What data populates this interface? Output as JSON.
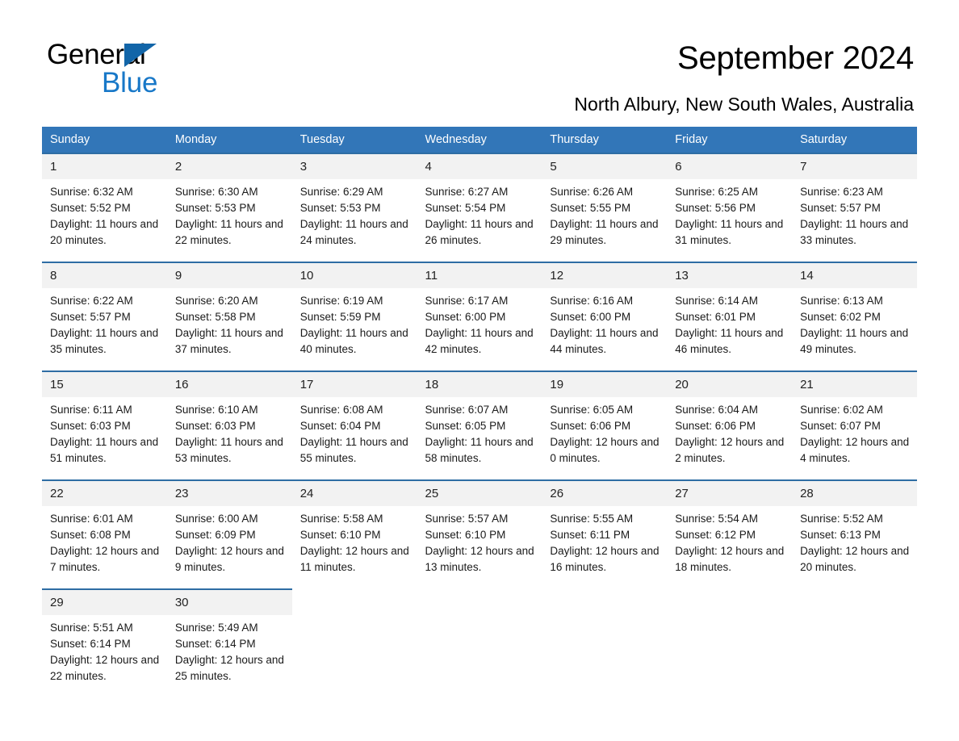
{
  "brand": {
    "name_part1": "General",
    "name_part2": "Blue",
    "accent_color": "#1878c8",
    "triangle_color": "#1265a8"
  },
  "header": {
    "title": "September 2024",
    "location": "North Albury, New South Wales, Australia"
  },
  "theme": {
    "header_bg": "#3276b8",
    "row_border": "#2e6da4",
    "daynum_bg": "#f2f2f2"
  },
  "calendar": {
    "weekday_headers": [
      "Sunday",
      "Monday",
      "Tuesday",
      "Wednesday",
      "Thursday",
      "Friday",
      "Saturday"
    ],
    "labels": {
      "sunrise_prefix": "Sunrise: ",
      "sunset_prefix": "Sunset: ",
      "daylight_prefix": "Daylight: "
    },
    "weeks": [
      [
        {
          "day": "1",
          "sunrise": "Sunrise: 6:32 AM",
          "sunset": "Sunset: 5:52 PM",
          "daylight": "Daylight: 11 hours and 20 minutes."
        },
        {
          "day": "2",
          "sunrise": "Sunrise: 6:30 AM",
          "sunset": "Sunset: 5:53 PM",
          "daylight": "Daylight: 11 hours and 22 minutes."
        },
        {
          "day": "3",
          "sunrise": "Sunrise: 6:29 AM",
          "sunset": "Sunset: 5:53 PM",
          "daylight": "Daylight: 11 hours and 24 minutes."
        },
        {
          "day": "4",
          "sunrise": "Sunrise: 6:27 AM",
          "sunset": "Sunset: 5:54 PM",
          "daylight": "Daylight: 11 hours and 26 minutes."
        },
        {
          "day": "5",
          "sunrise": "Sunrise: 6:26 AM",
          "sunset": "Sunset: 5:55 PM",
          "daylight": "Daylight: 11 hours and 29 minutes."
        },
        {
          "day": "6",
          "sunrise": "Sunrise: 6:25 AM",
          "sunset": "Sunset: 5:56 PM",
          "daylight": "Daylight: 11 hours and 31 minutes."
        },
        {
          "day": "7",
          "sunrise": "Sunrise: 6:23 AM",
          "sunset": "Sunset: 5:57 PM",
          "daylight": "Daylight: 11 hours and 33 minutes."
        }
      ],
      [
        {
          "day": "8",
          "sunrise": "Sunrise: 6:22 AM",
          "sunset": "Sunset: 5:57 PM",
          "daylight": "Daylight: 11 hours and 35 minutes."
        },
        {
          "day": "9",
          "sunrise": "Sunrise: 6:20 AM",
          "sunset": "Sunset: 5:58 PM",
          "daylight": "Daylight: 11 hours and 37 minutes."
        },
        {
          "day": "10",
          "sunrise": "Sunrise: 6:19 AM",
          "sunset": "Sunset: 5:59 PM",
          "daylight": "Daylight: 11 hours and 40 minutes."
        },
        {
          "day": "11",
          "sunrise": "Sunrise: 6:17 AM",
          "sunset": "Sunset: 6:00 PM",
          "daylight": "Daylight: 11 hours and 42 minutes."
        },
        {
          "day": "12",
          "sunrise": "Sunrise: 6:16 AM",
          "sunset": "Sunset: 6:00 PM",
          "daylight": "Daylight: 11 hours and 44 minutes."
        },
        {
          "day": "13",
          "sunrise": "Sunrise: 6:14 AM",
          "sunset": "Sunset: 6:01 PM",
          "daylight": "Daylight: 11 hours and 46 minutes."
        },
        {
          "day": "14",
          "sunrise": "Sunrise: 6:13 AM",
          "sunset": "Sunset: 6:02 PM",
          "daylight": "Daylight: 11 hours and 49 minutes."
        }
      ],
      [
        {
          "day": "15",
          "sunrise": "Sunrise: 6:11 AM",
          "sunset": "Sunset: 6:03 PM",
          "daylight": "Daylight: 11 hours and 51 minutes."
        },
        {
          "day": "16",
          "sunrise": "Sunrise: 6:10 AM",
          "sunset": "Sunset: 6:03 PM",
          "daylight": "Daylight: 11 hours and 53 minutes."
        },
        {
          "day": "17",
          "sunrise": "Sunrise: 6:08 AM",
          "sunset": "Sunset: 6:04 PM",
          "daylight": "Daylight: 11 hours and 55 minutes."
        },
        {
          "day": "18",
          "sunrise": "Sunrise: 6:07 AM",
          "sunset": "Sunset: 6:05 PM",
          "daylight": "Daylight: 11 hours and 58 minutes."
        },
        {
          "day": "19",
          "sunrise": "Sunrise: 6:05 AM",
          "sunset": "Sunset: 6:06 PM",
          "daylight": "Daylight: 12 hours and 0 minutes."
        },
        {
          "day": "20",
          "sunrise": "Sunrise: 6:04 AM",
          "sunset": "Sunset: 6:06 PM",
          "daylight": "Daylight: 12 hours and 2 minutes."
        },
        {
          "day": "21",
          "sunrise": "Sunrise: 6:02 AM",
          "sunset": "Sunset: 6:07 PM",
          "daylight": "Daylight: 12 hours and 4 minutes."
        }
      ],
      [
        {
          "day": "22",
          "sunrise": "Sunrise: 6:01 AM",
          "sunset": "Sunset: 6:08 PM",
          "daylight": "Daylight: 12 hours and 7 minutes."
        },
        {
          "day": "23",
          "sunrise": "Sunrise: 6:00 AM",
          "sunset": "Sunset: 6:09 PM",
          "daylight": "Daylight: 12 hours and 9 minutes."
        },
        {
          "day": "24",
          "sunrise": "Sunrise: 5:58 AM",
          "sunset": "Sunset: 6:10 PM",
          "daylight": "Daylight: 12 hours and 11 minutes."
        },
        {
          "day": "25",
          "sunrise": "Sunrise: 5:57 AM",
          "sunset": "Sunset: 6:10 PM",
          "daylight": "Daylight: 12 hours and 13 minutes."
        },
        {
          "day": "26",
          "sunrise": "Sunrise: 5:55 AM",
          "sunset": "Sunset: 6:11 PM",
          "daylight": "Daylight: 12 hours and 16 minutes."
        },
        {
          "day": "27",
          "sunrise": "Sunrise: 5:54 AM",
          "sunset": "Sunset: 6:12 PM",
          "daylight": "Daylight: 12 hours and 18 minutes."
        },
        {
          "day": "28",
          "sunrise": "Sunrise: 5:52 AM",
          "sunset": "Sunset: 6:13 PM",
          "daylight": "Daylight: 12 hours and 20 minutes."
        }
      ],
      [
        {
          "day": "29",
          "sunrise": "Sunrise: 5:51 AM",
          "sunset": "Sunset: 6:14 PM",
          "daylight": "Daylight: 12 hours and 22 minutes."
        },
        {
          "day": "30",
          "sunrise": "Sunrise: 5:49 AM",
          "sunset": "Sunset: 6:14 PM",
          "daylight": "Daylight: 12 hours and 25 minutes."
        },
        {
          "day": "",
          "sunrise": "",
          "sunset": "",
          "daylight": ""
        },
        {
          "day": "",
          "sunrise": "",
          "sunset": "",
          "daylight": ""
        },
        {
          "day": "",
          "sunrise": "",
          "sunset": "",
          "daylight": ""
        },
        {
          "day": "",
          "sunrise": "",
          "sunset": "",
          "daylight": ""
        },
        {
          "day": "",
          "sunrise": "",
          "sunset": "",
          "daylight": ""
        }
      ]
    ]
  }
}
